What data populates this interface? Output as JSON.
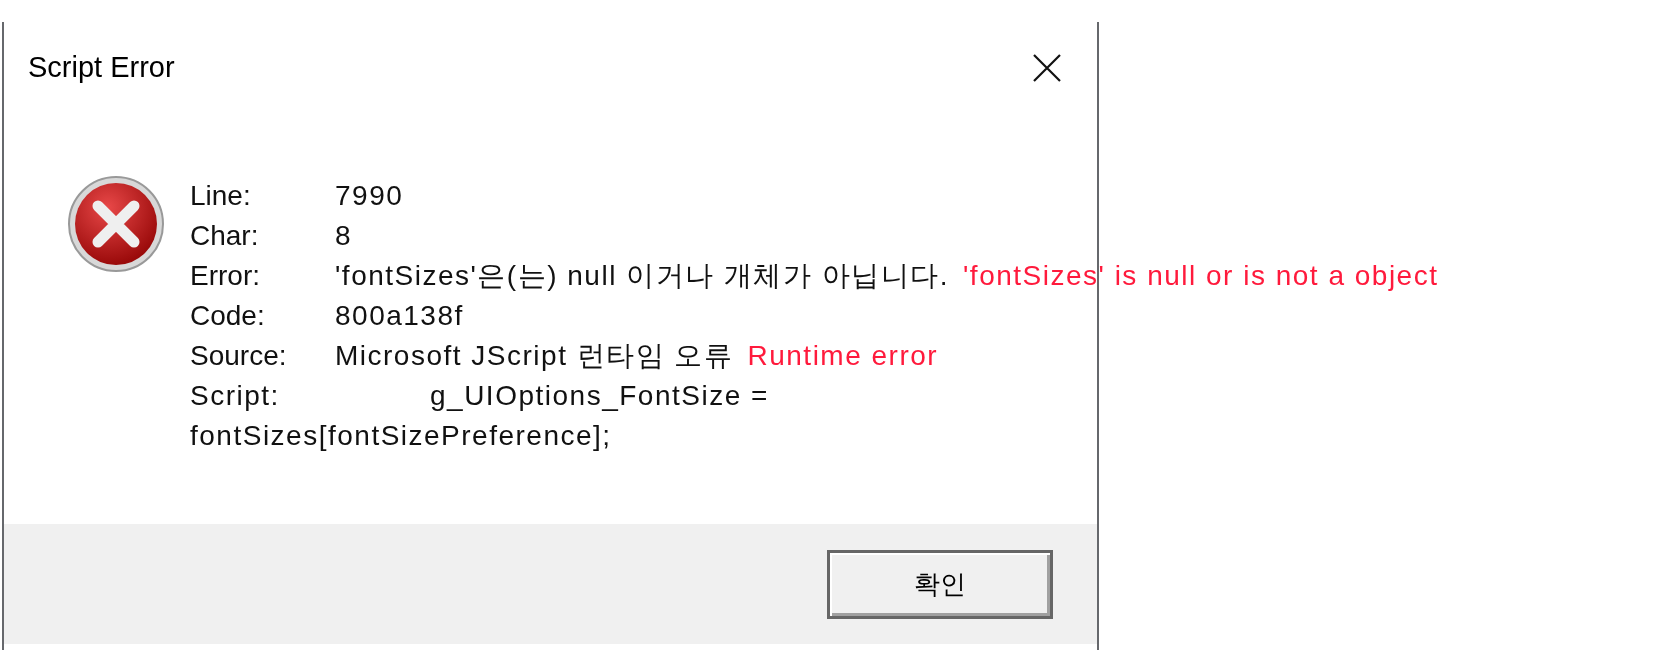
{
  "window": {
    "title": "Script Error"
  },
  "fields": [
    {
      "label": "Line:",
      "value": "7990"
    },
    {
      "label": "Char:",
      "value": "8"
    },
    {
      "label": "Error:",
      "value": "'fontSizes'은(는) null 이거나 개체가 아닙니다.",
      "annotation": "'fontSizes' is null or is not a object"
    },
    {
      "label": "Code:",
      "value": "800a138f"
    },
    {
      "label": "Source:",
      "value": "Microsoft JScript 런타임 오류",
      "annotation": "Runtime error"
    }
  ],
  "script": {
    "label": "Script:",
    "lines": [
      "g_UIOptions_FontSize =",
      "fontSizes[fontSizePreference];"
    ]
  },
  "buttons": [
    "확인"
  ]
}
